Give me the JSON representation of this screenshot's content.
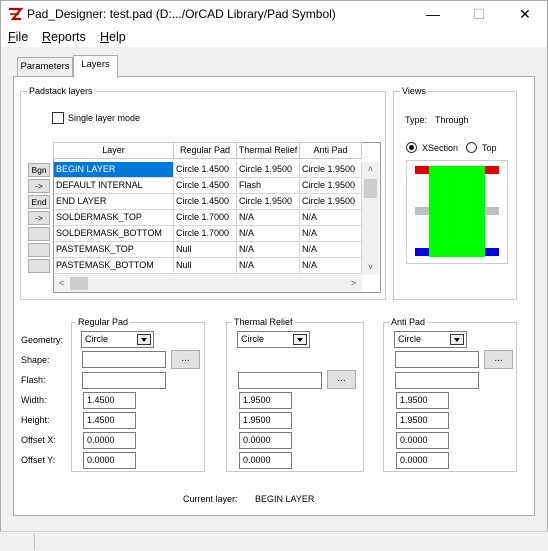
{
  "window": {
    "title": "Pad_Designer: test.pad (D:.../OrCAD Library/Pad Symbol)",
    "minimize_glyph": "—",
    "maximize_glyph": "☐",
    "close_glyph": "✕"
  },
  "menu": [
    {
      "label": "File",
      "mnemonic": "F",
      "rest": "ile"
    },
    {
      "label": "Reports",
      "mnemonic": "R",
      "rest": "eports"
    },
    {
      "label": "Help",
      "mnemonic": "H",
      "rest": "elp"
    }
  ],
  "tabs": [
    {
      "label": "Parameters",
      "active": false
    },
    {
      "label": "Layers",
      "active": true
    }
  ],
  "padstack": {
    "group_label": "Padstack layers",
    "single_layer_label": "Single layer mode",
    "single_layer_checked": false,
    "columns": [
      "Layer",
      "Regular Pad",
      "Thermal Relief",
      "Anti Pad"
    ],
    "row_buttons": [
      "Bgn",
      "->",
      "End",
      "->",
      "",
      "",
      ""
    ],
    "rows": [
      {
        "layer": "BEGIN LAYER",
        "regular": "Circle 1.4500",
        "thermal": "Circle 1.9500",
        "anti": "Circle 1.9500",
        "selected": true
      },
      {
        "layer": "DEFAULT INTERNAL",
        "regular": "Circle 1.4500",
        "thermal": "Flash",
        "anti": "Circle 1.9500",
        "selected": false
      },
      {
        "layer": "END LAYER",
        "regular": "Circle 1.4500",
        "thermal": "Circle 1.9500",
        "anti": "Circle 1.9500",
        "selected": false
      },
      {
        "layer": "SOLDERMASK_TOP",
        "regular": "Circle 1.7000",
        "thermal": "N/A",
        "anti": "N/A",
        "selected": false
      },
      {
        "layer": "SOLDERMASK_BOTTOM",
        "regular": "Circle 1.7000",
        "thermal": "N/A",
        "anti": "N/A",
        "selected": false
      },
      {
        "layer": "PASTEMASK_TOP",
        "regular": "Null",
        "thermal": "N/A",
        "anti": "N/A",
        "selected": false
      },
      {
        "layer": "PASTEMASK_BOTTOM",
        "regular": "Null",
        "thermal": "N/A",
        "anti": "N/A",
        "selected": false
      }
    ]
  },
  "views": {
    "group_label": "Views",
    "type_label": "Type:",
    "type_value": "Through",
    "options": [
      "XSection",
      "Top"
    ],
    "selected": "XSection",
    "colors": {
      "pad": "#00ff00",
      "top_layer": "#e00000",
      "internal": "#c0c0c0",
      "bottom_layer": "#0000e0",
      "accent": "#0078d7"
    }
  },
  "editor": {
    "row_labels": [
      "Geometry:",
      "Shape:",
      "Flash:",
      "Width:",
      "Height:",
      "Offset X:",
      "Offset Y:"
    ],
    "regular": {
      "label": "Regular Pad",
      "geometry": "Circle",
      "shape": "",
      "flash": "",
      "width": "1.4500",
      "height": "1.4500",
      "offset_x": "0.0000",
      "offset_y": "0.0000"
    },
    "thermal": {
      "label": "Thermal Relief",
      "geometry": "Circle",
      "flash": "",
      "width": "1.9500",
      "height": "1.9500",
      "offset_x": "0.0000",
      "offset_y": "0.0000"
    },
    "anti": {
      "label": "Anti Pad",
      "geometry": "Circle",
      "shape": "",
      "flash": "",
      "width": "1.9500",
      "height": "1.9500",
      "offset_x": "0.0000",
      "offset_y": "0.0000"
    },
    "browse_label": "...",
    "current_layer_label": "Current layer:",
    "current_layer_value": "BEGIN LAYER"
  },
  "scroll_glyphs": {
    "up": "˄",
    "down": "˅",
    "left": "<",
    "right": ">"
  }
}
